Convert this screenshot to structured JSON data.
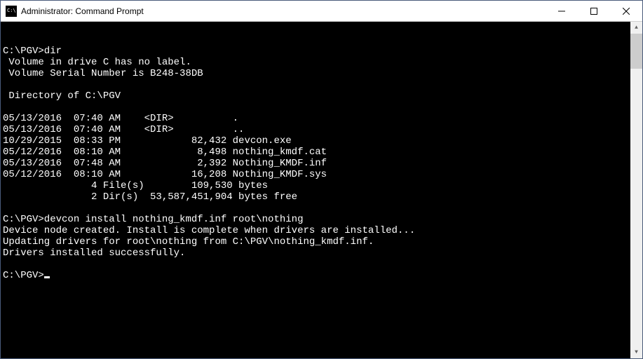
{
  "titlebar": {
    "title": "Administrator: Command Prompt"
  },
  "console": {
    "lines": [
      "C:\\PGV>dir",
      " Volume in drive C has no label.",
      " Volume Serial Number is B248-38DB",
      "",
      " Directory of C:\\PGV",
      "",
      "05/13/2016  07:40 AM    <DIR>          .",
      "05/13/2016  07:40 AM    <DIR>          ..",
      "10/29/2015  08:33 PM            82,432 devcon.exe",
      "05/12/2016  08:10 AM             8,498 nothing_kmdf.cat",
      "05/13/2016  07:48 AM             2,392 Nothing_KMDF.inf",
      "05/12/2016  08:10 AM            16,208 Nothing_KMDF.sys",
      "               4 File(s)        109,530 bytes",
      "               2 Dir(s)  53,587,451,904 bytes free",
      "",
      "C:\\PGV>devcon install nothing_kmdf.inf root\\nothing",
      "Device node created. Install is complete when drivers are installed...",
      "Updating drivers for root\\nothing from C:\\PGV\\nothing_kmdf.inf.",
      "Drivers installed successfully.",
      "",
      "C:\\PGV>"
    ]
  }
}
